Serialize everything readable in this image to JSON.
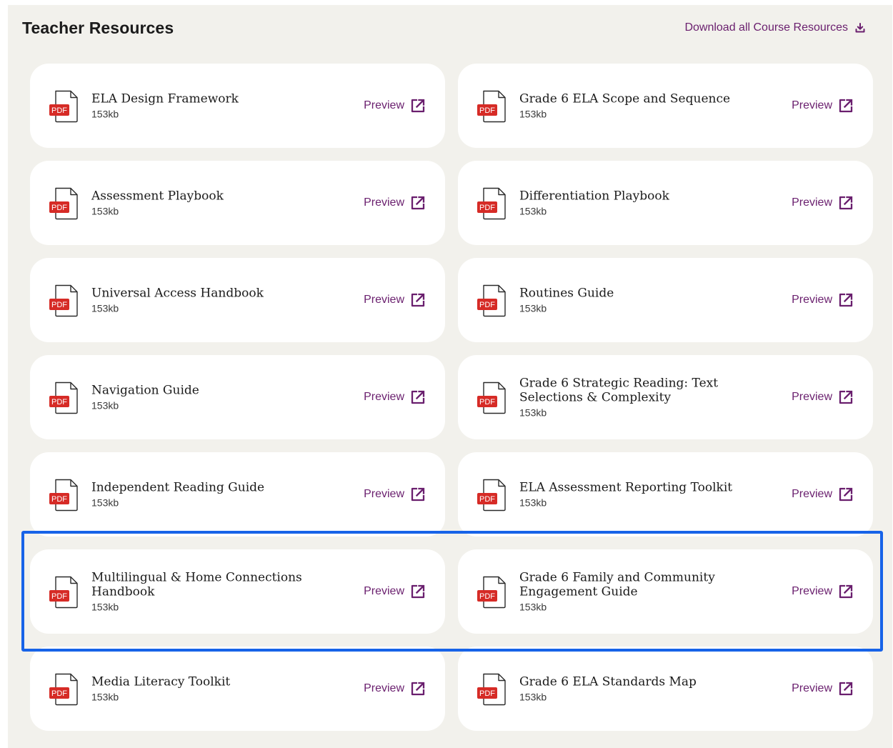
{
  "header": {
    "title": "Teacher Resources",
    "download_label": "Download all Course Resources"
  },
  "colors": {
    "accent": "#6a1f6e",
    "pdf_red": "#d62b26",
    "highlight": "#1763e8",
    "panel_bg": "#f2f1ec"
  },
  "icons": {
    "file": "pdf-file-icon",
    "preview": "external-link-icon",
    "download": "download-icon"
  },
  "resources": [
    {
      "title": "ELA Design Framework",
      "size": "153kb",
      "badge": "PDF",
      "action": "Preview"
    },
    {
      "title": "Grade 6 ELA Scope and Sequence",
      "size": "153kb",
      "badge": "PDF",
      "action": "Preview"
    },
    {
      "title": "Assessment Playbook",
      "size": "153kb",
      "badge": "PDF",
      "action": "Preview"
    },
    {
      "title": "Differentiation Playbook",
      "size": "153kb",
      "badge": "PDF",
      "action": "Preview"
    },
    {
      "title": "Universal Access Handbook",
      "size": "153kb",
      "badge": "PDF",
      "action": "Preview"
    },
    {
      "title": "Routines Guide",
      "size": "153kb",
      "badge": "PDF",
      "action": "Preview"
    },
    {
      "title": "Navigation Guide",
      "size": "153kb",
      "badge": "PDF",
      "action": "Preview"
    },
    {
      "title": "Grade 6 Strategic Reading: Text Selections & Complexity",
      "size": "153kb",
      "badge": "PDF",
      "action": "Preview"
    },
    {
      "title": "Independent Reading Guide",
      "size": "153kb",
      "badge": "PDF",
      "action": "Preview"
    },
    {
      "title": "ELA Assessment Reporting Toolkit",
      "size": "153kb",
      "badge": "PDF",
      "action": "Preview"
    },
    {
      "title": "Multilingual & Home Connections Handbook",
      "size": "153kb",
      "badge": "PDF",
      "action": "Preview"
    },
    {
      "title": "Grade 6 Family and Community Engagement Guide",
      "size": "153kb",
      "badge": "PDF",
      "action": "Preview"
    },
    {
      "title": "Media Literacy Toolkit",
      "size": "153kb",
      "badge": "PDF",
      "action": "Preview"
    },
    {
      "title": "Grade 6 ELA Standards Map",
      "size": "153kb",
      "badge": "PDF",
      "action": "Preview"
    }
  ]
}
